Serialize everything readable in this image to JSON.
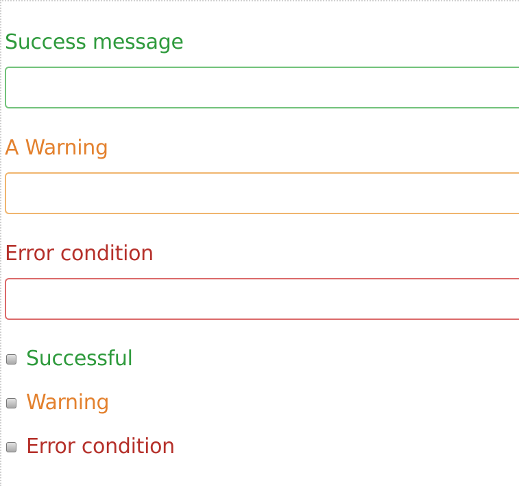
{
  "colors": {
    "success": "#2e9a3c",
    "warning": "#e3812e",
    "error": "#b5302a",
    "success_border": "#72c27a",
    "warning_border": "#f0b56e",
    "error_border": "#db6a6a"
  },
  "form": {
    "fields": [
      {
        "label": "Success message",
        "value": "",
        "status": "success"
      },
      {
        "label": "A Warning",
        "value": "",
        "status": "warning"
      },
      {
        "label": "Error condition",
        "value": "",
        "status": "error"
      }
    ],
    "checkboxes": [
      {
        "label": "Successful",
        "status": "success",
        "checked": false
      },
      {
        "label": "Warning",
        "status": "warning",
        "checked": false
      },
      {
        "label": "Error condition",
        "status": "error",
        "checked": false
      }
    ]
  }
}
